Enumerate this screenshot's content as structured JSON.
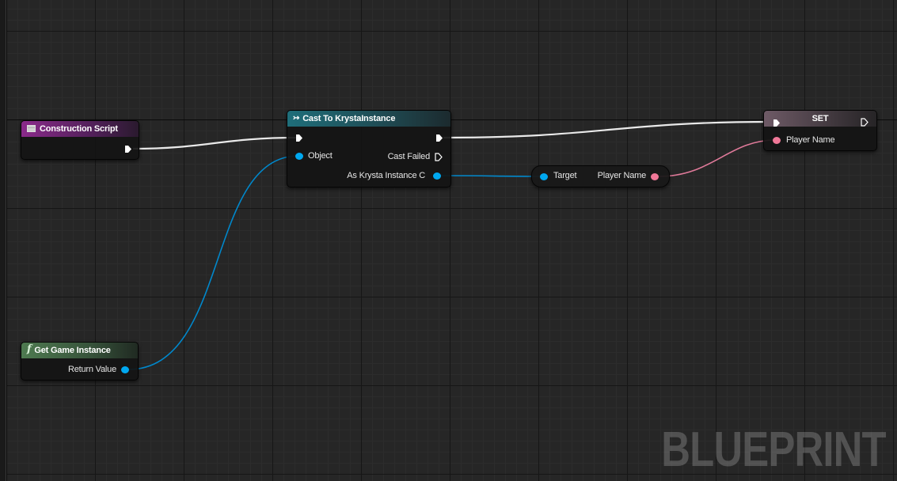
{
  "graph": {
    "watermark": "BLUEPRINT"
  },
  "nodes": {
    "construction_script": {
      "title": "Construction Script",
      "header_color": "#8a2a8a"
    },
    "get_game_instance": {
      "title": "Get Game Instance",
      "icon": "function-icon",
      "header_color": "#4e7a50",
      "pins": {
        "return_value": "Return Value"
      }
    },
    "cast_to": {
      "title": "Cast To KrystaInstance",
      "icon": "cast-arrow-icon",
      "header_color": "#1f6e7a",
      "pins": {
        "object": "Object",
        "cast_failed": "Cast Failed",
        "as_instance": "As Krysta Instance C"
      }
    },
    "get_player_name": {
      "pins": {
        "target": "Target",
        "player_name": "Player Name"
      }
    },
    "set_node": {
      "title": "SET",
      "header_color": "#6e5a66",
      "pins": {
        "player_name": "Player Name"
      }
    }
  },
  "colors": {
    "exec_wire": "#ffffff",
    "object_wire": "#0088cc",
    "string_wire": "#e07a9a",
    "object_pin": "#00a8f0",
    "string_pin": "#f07898"
  }
}
